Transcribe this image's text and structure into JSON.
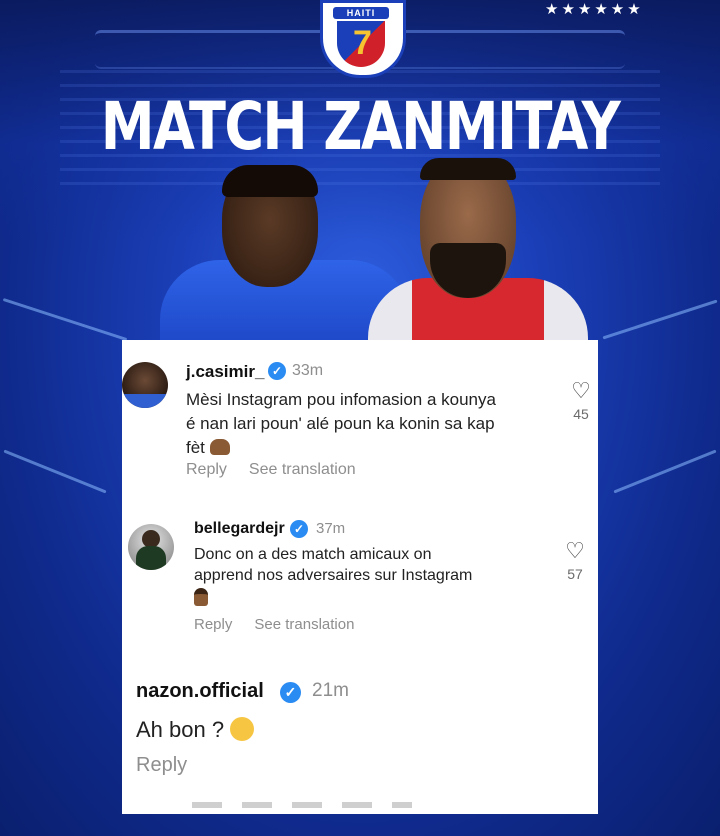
{
  "poster": {
    "title": "MATCH ZANMITAY",
    "logo_text": "HAITI",
    "logo_icon": "haiti-federation-crest",
    "stars": "★★★★★★",
    "colors": {
      "background": "#1b3fb8",
      "accent_red": "#d0202a",
      "text": "#ffffff"
    }
  },
  "comments": [
    {
      "username": "j.casimir_",
      "verified": true,
      "time": "33m",
      "text_line1": "Mèsi Instagram pou infomasion a kounya",
      "text_line2": "é nan lari poun' alé poun ka konin sa kap",
      "text_line3": "fèt",
      "emoji": "raising-hands",
      "reply_label": "Reply",
      "translate_label": "See translation",
      "likes": "45"
    },
    {
      "username": "bellegardejr",
      "verified": true,
      "time": "37m",
      "text_line1": "Donc on a des match amicaux on",
      "text_line2": "apprend nos adversaires sur Instagram",
      "emoji": "person-shrugging",
      "reply_label": "Reply",
      "translate_label": "See translation",
      "likes": "57"
    },
    {
      "username": "nazon.official",
      "verified": true,
      "time": "21m",
      "text": "Ah bon ?",
      "emoji": "sweat-smile",
      "reply_label": "Reply"
    }
  ]
}
